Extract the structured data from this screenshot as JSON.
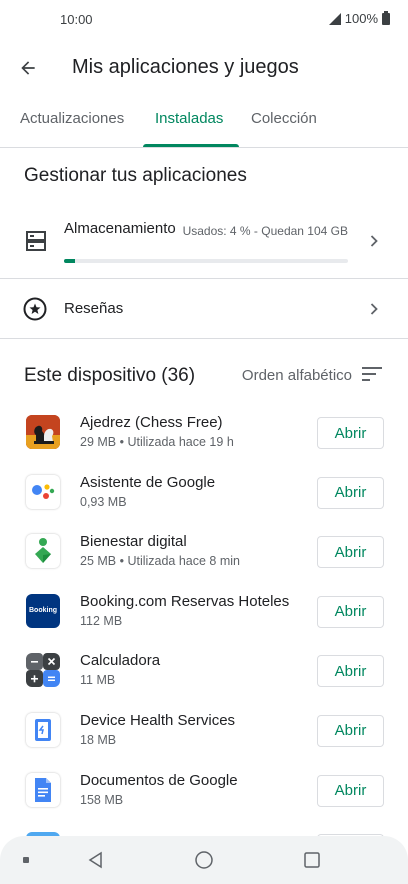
{
  "status": {
    "time": "10:00",
    "battery": "100%"
  },
  "header": {
    "title": "Mis aplicaciones y juegos"
  },
  "tabs": [
    {
      "label": "Actualizaciones",
      "active": false
    },
    {
      "label": "Instaladas",
      "active": true
    },
    {
      "label": "Colección",
      "active": false
    }
  ],
  "manage": {
    "title": "Gestionar tus aplicaciones",
    "storage": {
      "label": "Almacenamiento",
      "info": "Usados: 4 % - Quedan 104 GB",
      "used_percent": 4
    },
    "reviews": {
      "label": "Reseñas"
    }
  },
  "device": {
    "title": "Este dispositivo (36)",
    "sort_label": "Orden alfabético"
  },
  "apps": [
    {
      "name": "Ajedrez (Chess Free)",
      "meta": "29 MB • Utilizada hace 19 h",
      "button": "Abrir",
      "icon": "chess-icon"
    },
    {
      "name": "Asistente de Google",
      "meta": "0,93 MB",
      "button": "Abrir",
      "icon": "google-assistant-icon"
    },
    {
      "name": "Bienestar digital",
      "meta": "25 MB • Utilizada hace 8 min",
      "button": "Abrir",
      "icon": "digital-wellbeing-icon"
    },
    {
      "name": "Booking.com Reservas Hoteles",
      "meta": "112 MB",
      "button": "Abrir",
      "icon": "booking-icon",
      "icon_text": "Booking"
    },
    {
      "name": "Calculadora",
      "meta": "11 MB",
      "button": "Abrir",
      "icon": "calculator-icon"
    },
    {
      "name": "Device Health Services",
      "meta": "18 MB",
      "button": "Abrir",
      "icon": "device-health-icon"
    },
    {
      "name": "Documentos de Google",
      "meta": "158 MB",
      "button": "Abrir",
      "icon": "google-docs-icon"
    }
  ],
  "colors": {
    "accent": "#01875f",
    "text": "#202124",
    "secondary": "#5f6368",
    "divider": "#dadce0"
  }
}
